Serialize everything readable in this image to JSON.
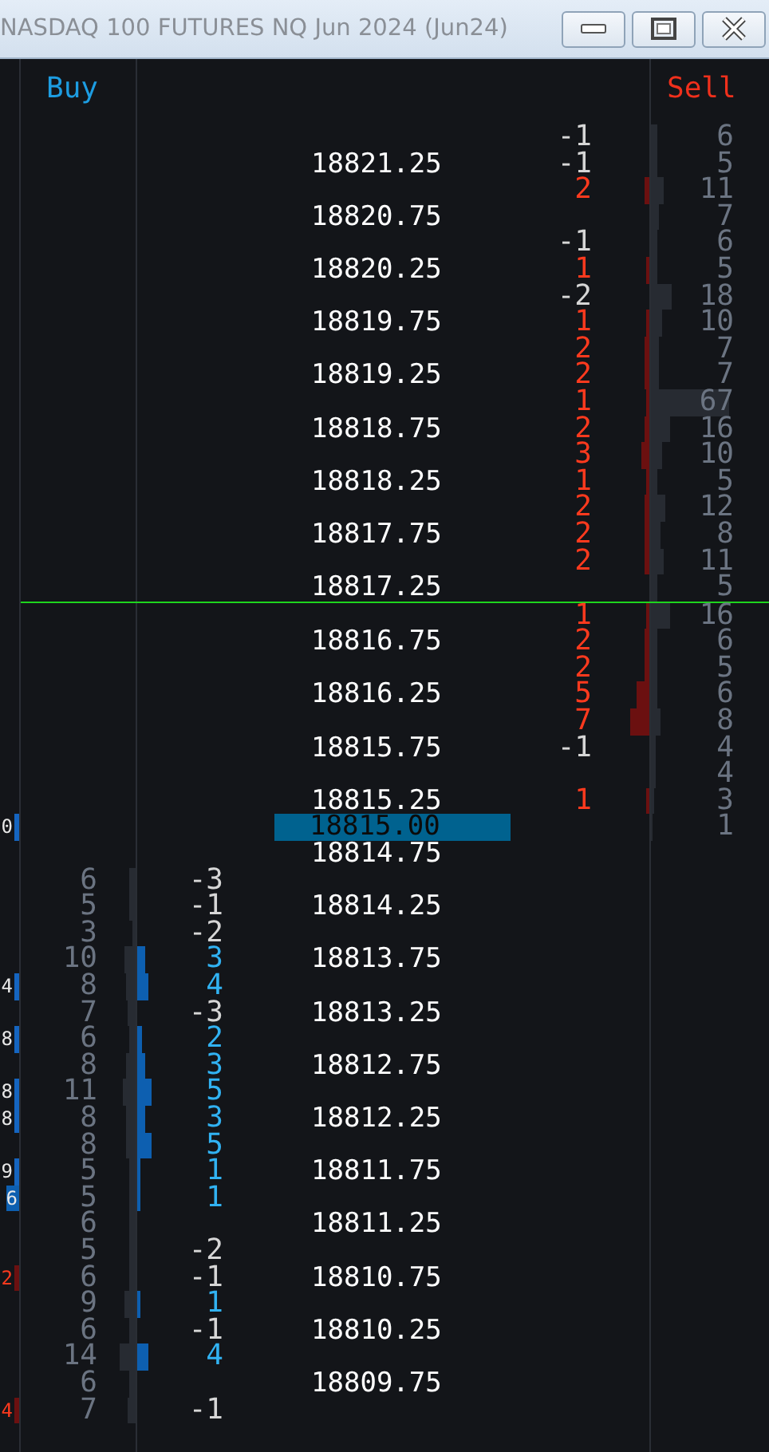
{
  "window": {
    "title": "NASDAQ 100 FUTURES NQ Jun 2024 (Jun24)"
  },
  "headers": {
    "buy": "Buy",
    "sell": "Sell"
  },
  "rows": [
    {
      "kind": "sell",
      "delta": "-1",
      "volume": "6"
    },
    {
      "kind": "sell",
      "price": "18821.25",
      "delta": "-1",
      "volume": "5"
    },
    {
      "kind": "sell",
      "delta": "2",
      "volume": "11"
    },
    {
      "kind": "sell",
      "price": "18820.75",
      "volume": "7"
    },
    {
      "kind": "sell",
      "delta": "-1",
      "volume": "6"
    },
    {
      "kind": "sell",
      "price": "18820.25",
      "delta": "1",
      "volume": "5"
    },
    {
      "kind": "sell",
      "delta": "-2",
      "volume": "18"
    },
    {
      "kind": "sell",
      "price": "18819.75",
      "delta": "1",
      "volume": "10"
    },
    {
      "kind": "sell",
      "delta": "2",
      "volume": "7"
    },
    {
      "kind": "sell",
      "price": "18819.25",
      "delta": "2",
      "volume": "7"
    },
    {
      "kind": "sell",
      "delta": "1",
      "volume": "67"
    },
    {
      "kind": "sell",
      "price": "18818.75",
      "delta": "2",
      "volume": "16"
    },
    {
      "kind": "sell",
      "delta": "3",
      "volume": "10"
    },
    {
      "kind": "sell",
      "price": "18818.25",
      "delta": "1",
      "volume": "5"
    },
    {
      "kind": "sell",
      "delta": "2",
      "volume": "12"
    },
    {
      "kind": "sell",
      "price": "18817.75",
      "delta": "2",
      "volume": "8"
    },
    {
      "kind": "sell",
      "delta": "2",
      "volume": "11"
    },
    {
      "kind": "sell",
      "price": "18817.25",
      "volume": "5"
    },
    {
      "kind": "sell",
      "line_above": true,
      "delta": "1",
      "volume": "16"
    },
    {
      "kind": "sell",
      "price": "18816.75",
      "delta": "2",
      "volume": "6"
    },
    {
      "kind": "sell",
      "delta": "2",
      "volume": "5"
    },
    {
      "kind": "sell",
      "price": "18816.25",
      "delta": "5",
      "volume": "6"
    },
    {
      "kind": "sell",
      "delta": "7",
      "volume": "8"
    },
    {
      "kind": "sell",
      "price": "18815.75",
      "delta": "-1",
      "volume": "4"
    },
    {
      "kind": "sell",
      "volume": "4"
    },
    {
      "kind": "sell",
      "price": "18815.25",
      "delta": "1",
      "volume": "3"
    },
    {
      "kind": "sell",
      "price": "18815.00",
      "current": true,
      "volume": "1",
      "edge": {
        "text": "0",
        "kind": "buy"
      }
    },
    {
      "kind": "buy",
      "price": "18814.75"
    },
    {
      "kind": "buy",
      "volume": "6",
      "delta": "-3"
    },
    {
      "kind": "buy",
      "price": "18814.25",
      "volume": "5",
      "delta": "-1"
    },
    {
      "kind": "buy",
      "volume": "3",
      "delta": "-2"
    },
    {
      "kind": "buy",
      "price": "18813.75",
      "volume": "10",
      "delta": "3"
    },
    {
      "kind": "buy",
      "volume": "8",
      "delta": "4",
      "edge": {
        "text": "4",
        "kind": "buy"
      }
    },
    {
      "kind": "buy",
      "price": "18813.25",
      "volume": "7",
      "delta": "-3"
    },
    {
      "kind": "buy",
      "volume": "6",
      "delta": "2",
      "edge": {
        "text": "8",
        "kind": "buy"
      }
    },
    {
      "kind": "buy",
      "price": "18812.75",
      "volume": "8",
      "delta": "3"
    },
    {
      "kind": "buy",
      "volume": "11",
      "delta": "5",
      "edge": {
        "text": "8",
        "kind": "buy"
      }
    },
    {
      "kind": "buy",
      "price": "18812.25",
      "volume": "8",
      "delta": "3",
      "edge": {
        "text": "8",
        "kind": "buy"
      }
    },
    {
      "kind": "buy",
      "volume": "8",
      "delta": "5"
    },
    {
      "kind": "buy",
      "price": "18811.75",
      "volume": "5",
      "delta": "1",
      "edge": {
        "text": "9",
        "kind": "buy"
      }
    },
    {
      "kind": "buy",
      "volume": "5",
      "delta": "1",
      "edge": {
        "text": "6",
        "kind": "highlight"
      }
    },
    {
      "kind": "buy",
      "price": "18811.25",
      "volume": "6"
    },
    {
      "kind": "buy",
      "volume": "5",
      "delta": "-2"
    },
    {
      "kind": "buy",
      "price": "18810.75",
      "volume": "6",
      "delta": "-1",
      "edge": {
        "text": "2",
        "kind": "sell"
      }
    },
    {
      "kind": "buy",
      "volume": "9",
      "delta": "1"
    },
    {
      "kind": "buy",
      "price": "18810.25",
      "volume": "6",
      "delta": "-1"
    },
    {
      "kind": "buy",
      "volume": "14",
      "delta": "4"
    },
    {
      "kind": "buy",
      "price": "18809.75",
      "volume": "6"
    },
    {
      "kind": "buy",
      "volume": "7",
      "delta": "-1",
      "edge": {
        "text": "4",
        "kind": "sell"
      }
    }
  ]
}
